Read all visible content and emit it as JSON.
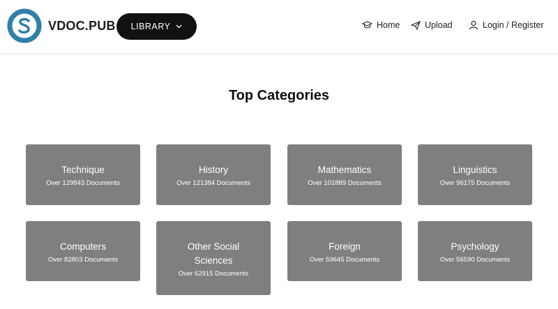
{
  "brand": {
    "name": "VDOC.PUB",
    "color_primary": "#2f7fa8"
  },
  "header": {
    "library_label": "LIBRARY",
    "nav": [
      {
        "label": "Home",
        "icon": "graduation-cap-icon"
      },
      {
        "label": "Upload",
        "icon": "paper-plane-icon"
      },
      {
        "label": "Login / Register",
        "icon": "user-icon"
      }
    ]
  },
  "main": {
    "title": "Top Categories",
    "categories": [
      {
        "name": "Technique",
        "count": "Over 129843 Documents"
      },
      {
        "name": "History",
        "count": "Over 121384 Documents"
      },
      {
        "name": "Mathematics",
        "count": "Over 101889 Documents"
      },
      {
        "name": "Linguistics",
        "count": "Over 96175 Documents"
      },
      {
        "name": "Computers",
        "count": "Over 82803 Documents"
      },
      {
        "name": "Other Social Sciences",
        "count": "Over 62915 Documents"
      },
      {
        "name": "Foreign",
        "count": "Over 59645 Documents"
      },
      {
        "name": "Psychology",
        "count": "Over 56590 Documents"
      }
    ]
  },
  "colors": {
    "card_bg": "#7f7f7f",
    "button_bg": "#111111"
  }
}
